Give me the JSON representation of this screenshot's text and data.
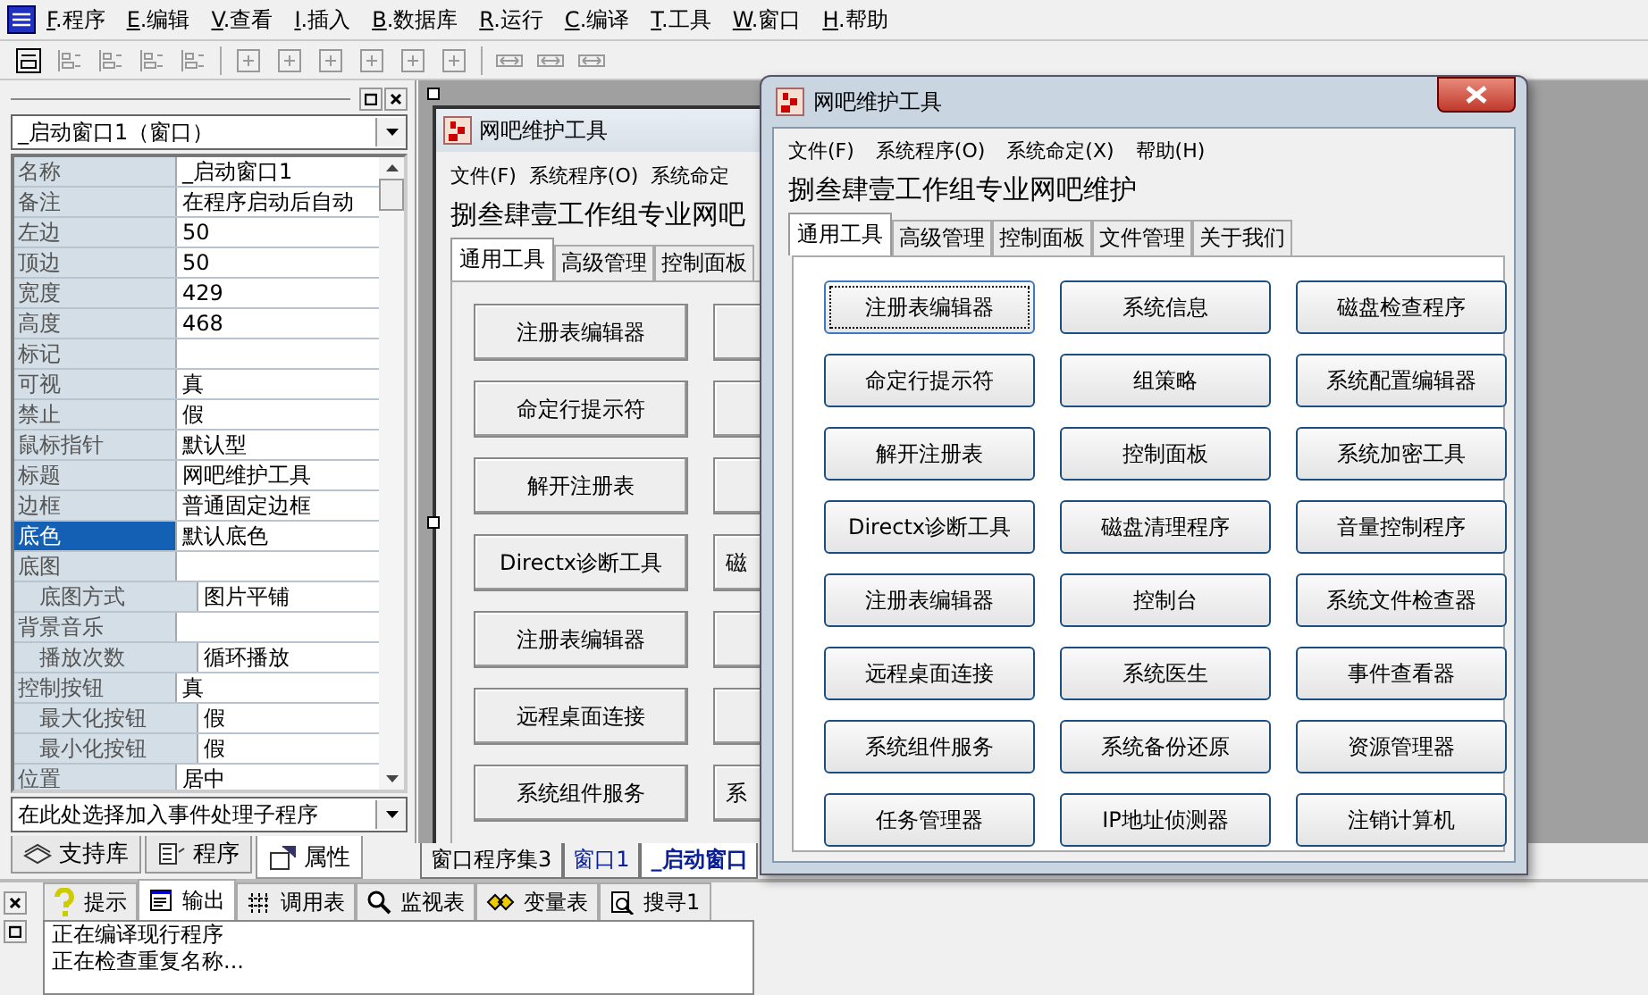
{
  "menubar": [
    "F.程序",
    "E.编辑",
    "V.查看",
    "I.插入",
    "B.数据库",
    "R.运行",
    "C.编译",
    "T.工具",
    "W.窗口",
    "H.帮助"
  ],
  "left_panel": {
    "object_combo": "_启动窗口1（窗口）",
    "properties": [
      {
        "name": "名称",
        "value": "_启动窗口1",
        "selected": false
      },
      {
        "name": "备注",
        "value": "在程序启动后自动",
        "selected": false
      },
      {
        "name": "左边",
        "value": "50",
        "selected": false
      },
      {
        "name": "顶边",
        "value": "50",
        "selected": false
      },
      {
        "name": "宽度",
        "value": "429",
        "selected": false
      },
      {
        "name": "高度",
        "value": "468",
        "selected": false
      },
      {
        "name": "标记",
        "selected": false
      },
      {
        "name": "可视",
        "value": "真",
        "selected": false
      },
      {
        "name": "禁止",
        "value": "假",
        "selected": false
      },
      {
        "name": "鼠标指针",
        "value": "默认型",
        "selected": false
      },
      {
        "name": "标题",
        "value": "网吧维护工具",
        "selected": false
      },
      {
        "name": "边框",
        "value": "普通固定边框",
        "selected": false
      },
      {
        "name": "底色",
        "value": "默认底色",
        "selected": true
      },
      {
        "name": "底图",
        "selected": false,
        "children": [
          {
            "name": "底图方式",
            "value": "图片平铺",
            "selected": false
          }
        ]
      },
      {
        "name": "背景音乐",
        "selected": false,
        "children": [
          {
            "name": "播放次数",
            "value": "循环播放",
            "selected": false
          }
        ]
      },
      {
        "name": "控制按钮",
        "value": "真",
        "selected": false,
        "children": [
          {
            "name": "最大化按钮",
            "value": "假",
            "selected": false
          },
          {
            "name": "最小化按钮",
            "value": "假",
            "selected": false
          }
        ]
      },
      {
        "name": "位置",
        "value": "居中",
        "selected": false
      }
    ],
    "event_combo": "在此处选择加入事件处理子程序",
    "tabs": [
      {
        "label": "支持库",
        "selected": false
      },
      {
        "label": "程序",
        "selected": false
      },
      {
        "label": "属性",
        "selected": true
      }
    ]
  },
  "designer": {
    "form": {
      "title": "网吧维护工具",
      "menu": [
        "文件(F)",
        "系统程序(O)",
        "系统命定"
      ],
      "heading": "捌叁肆壹工作组专业网吧",
      "tabs": [
        {
          "label": "通用工具",
          "selected": true
        },
        {
          "label": "高级管理",
          "selected": false
        },
        {
          "label": "控制面板",
          "selected": false
        }
      ],
      "button_rows": [
        {
          "left": "注册表编辑器"
        },
        {
          "left": "命定行提示符"
        },
        {
          "left": "解开注册表"
        },
        {
          "left": "Directx诊断工具",
          "right": "磁"
        },
        {
          "left": "注册表编辑器"
        },
        {
          "left": "远程桌面连接"
        },
        {
          "left": "系统组件服务",
          "right": "系"
        }
      ]
    },
    "doc_tabs": [
      {
        "label": "窗口程序集3",
        "selected": false,
        "kind": "module"
      },
      {
        "label": "窗口1",
        "selected": false,
        "kind": "window"
      },
      {
        "label": "_启动窗口",
        "selected": true,
        "kind": "window"
      }
    ]
  },
  "dialog": {
    "title": "网吧维护工具",
    "menu": [
      "文件(F)",
      "系统程序(O)",
      "系统命定(X)",
      "帮助(H)"
    ],
    "heading": "捌叁肆壹工作组专业网吧维护",
    "tabs": [
      {
        "label": "通用工具",
        "selected": true
      },
      {
        "label": "高级管理",
        "selected": false
      },
      {
        "label": "控制面板",
        "selected": false
      },
      {
        "label": "文件管理",
        "selected": false
      },
      {
        "label": "关于我们",
        "selected": false
      }
    ],
    "buttons": [
      {
        "label": "注册表编辑器",
        "focused": true
      },
      {
        "label": "系统信息",
        "focused": false
      },
      {
        "label": "磁盘检查程序",
        "focused": false
      },
      {
        "label": "命定行提示符",
        "focused": false
      },
      {
        "label": "组策略",
        "focused": false
      },
      {
        "label": "系统配置编辑器",
        "focused": false
      },
      {
        "label": "解开注册表",
        "focused": false
      },
      {
        "label": "控制面板",
        "focused": false
      },
      {
        "label": "系统加密工具",
        "focused": false
      },
      {
        "label": "Directx诊断工具",
        "focused": false
      },
      {
        "label": "磁盘清理程序",
        "focused": false
      },
      {
        "label": "音量控制程序",
        "focused": false
      },
      {
        "label": "注册表编辑器",
        "focused": false
      },
      {
        "label": "控制台",
        "focused": false
      },
      {
        "label": "系统文件检查器",
        "focused": false
      },
      {
        "label": "远程桌面连接",
        "focused": false
      },
      {
        "label": "系统医生",
        "focused": false
      },
      {
        "label": "事件查看器",
        "focused": false
      },
      {
        "label": "系统组件服务",
        "focused": false
      },
      {
        "label": "系统备份还原",
        "focused": false
      },
      {
        "label": "资源管理器",
        "focused": false
      },
      {
        "label": "任务管理器",
        "focused": false
      },
      {
        "label": "IP地址侦测器",
        "focused": false
      },
      {
        "label": "注销计算机",
        "focused": false
      }
    ]
  },
  "bottom_panel": {
    "tabs": [
      {
        "label": "提示",
        "selected": false
      },
      {
        "label": "输出",
        "selected": true
      },
      {
        "label": "调用表",
        "selected": false
      },
      {
        "label": "监视表",
        "selected": false
      },
      {
        "label": "变量表",
        "selected": false
      },
      {
        "label": "搜寻1",
        "selected": false
      }
    ],
    "output_lines": [
      "正在编译现行程序",
      "正在检查重复名称..."
    ]
  }
}
